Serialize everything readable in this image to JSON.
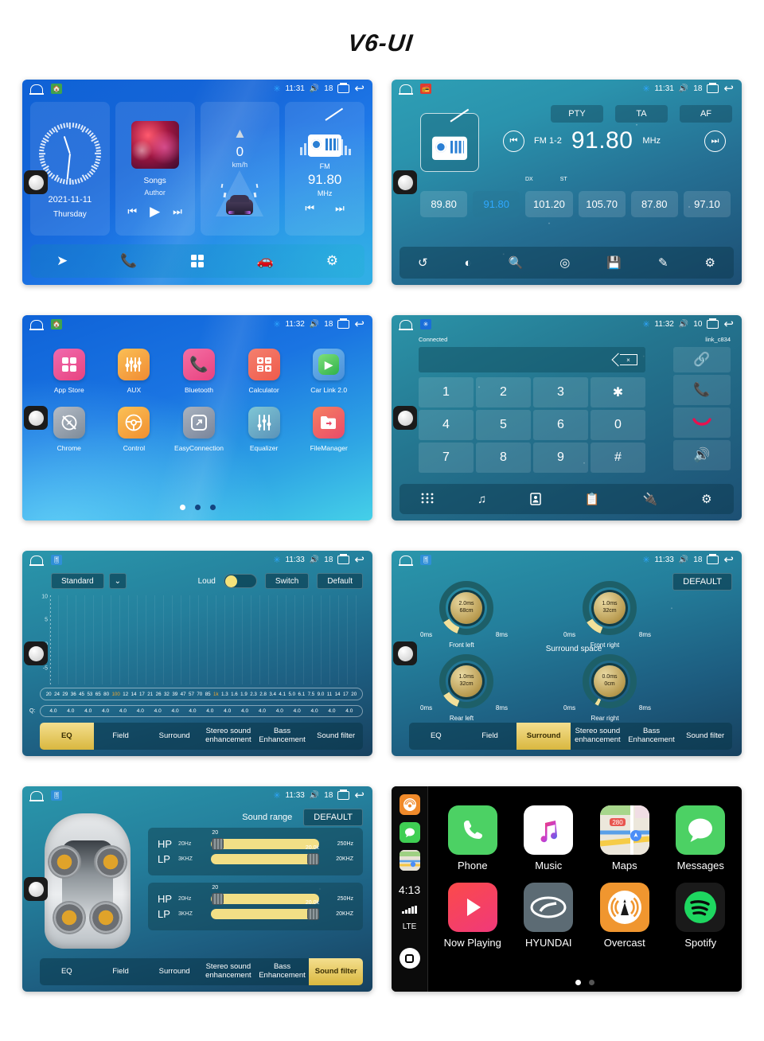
{
  "title": "V6-UI",
  "statusbar_common": {
    "bt_icon": "bluetooth-icon",
    "recents_icon": "recents-icon",
    "back_icon": "back-icon"
  },
  "screens": {
    "home": {
      "name": "home-screen",
      "status": {
        "time": "11:31",
        "volume": "18"
      },
      "clock_card": {
        "date": "2021-11-11",
        "day": "Thursday"
      },
      "music_card": {
        "title": "Songs",
        "author": "Author",
        "prev": "⏮",
        "play": "▶",
        "next": "⏭"
      },
      "drive_card": {
        "speed": "0",
        "unit": "km/h"
      },
      "radio_card": {
        "band": "FM",
        "freq": "91.80",
        "unit": "MHz",
        "prev": "⏮",
        "next": "⏭"
      },
      "dock": [
        "navigation-icon",
        "phone-icon",
        "apps-icon",
        "carplay-icon",
        "settings-icon"
      ]
    },
    "radio": {
      "name": "radio-screen",
      "status": {
        "time": "11:31",
        "volume": "18"
      },
      "rds": [
        "PTY",
        "TA",
        "AF"
      ],
      "band": "FM 1-2",
      "freq": "91.80",
      "unit": "MHz",
      "dx": "DX",
      "st": "ST",
      "presets": [
        "89.80",
        "91.80",
        "101.20",
        "105.70",
        "87.80",
        "97.10"
      ],
      "active_preset_index": 1,
      "toolbar": [
        "loop-icon",
        "contrast-icon",
        "search-icon",
        "scan-icon",
        "save-icon",
        "edit-icon",
        "settings-icon"
      ]
    },
    "apps": {
      "name": "apps-screen",
      "status": {
        "time": "11:32",
        "volume": "18"
      },
      "items": [
        {
          "label": "App Store",
          "icon": "grid-icon",
          "color": "#f0509a"
        },
        {
          "label": "AUX",
          "icon": "sliders-icon",
          "color": "#f5a23a"
        },
        {
          "label": "Bluetooth",
          "icon": "phone-icon",
          "color": "#f04f8e"
        },
        {
          "label": "Calculator",
          "icon": "calculator-icon",
          "color": "#f2644f"
        },
        {
          "label": "Car Link 2.0",
          "icon": "play-circle-icon",
          "color": "#4f9ee8"
        },
        {
          "label": "Chrome",
          "icon": "compass-off-icon",
          "color": "#9aa3ad"
        },
        {
          "label": "Control",
          "icon": "steering-wheel-icon",
          "color": "#f5a13a"
        },
        {
          "label": "EasyConnection",
          "icon": "screen-mirror-icon",
          "color": "#8d97a3"
        },
        {
          "label": "Equalizer",
          "icon": "faders-icon",
          "color": "#59b6c9"
        },
        {
          "label": "FileManager",
          "icon": "folder-icon",
          "color": "#f0564f"
        }
      ],
      "page_dots": 3,
      "active_dot": 0
    },
    "dialer": {
      "name": "dialer-screen",
      "status": {
        "time": "11:32",
        "volume": "10"
      },
      "connected_label": "Connected",
      "device_name": "link_c834",
      "input_value": "",
      "backspace_icon": "backspace-icon",
      "keys": [
        "1",
        "2",
        "3",
        "✱",
        "4",
        "5",
        "6",
        "0",
        "7",
        "8",
        "9",
        "#"
      ],
      "side": [
        "link-icon",
        "call-icon",
        "hangup-icon",
        "speaker-icon"
      ],
      "toolbar": [
        "keypad-icon",
        "music-icon",
        "contacts-icon",
        "call-log-icon",
        "bluetooth-connect-icon",
        "settings-icon"
      ]
    },
    "eq": {
      "name": "equalizer-screen",
      "status": {
        "time": "11:33",
        "volume": "18"
      },
      "preset_name": "Standard",
      "loud_label": "Loud",
      "loud_on": true,
      "switch_label": "Switch",
      "default_label": "Default",
      "y_ticks": [
        "10",
        "5",
        "0",
        "-5"
      ],
      "freq_labels": [
        "20",
        "24",
        "29",
        "36",
        "45",
        "53",
        "65",
        "80",
        "100",
        "12",
        "14",
        "17",
        "21",
        "26",
        "32",
        "39",
        "47",
        "57",
        "70",
        "85",
        "1k",
        "1.3",
        "1.6",
        "1.9",
        "2.3",
        "2.8",
        "3.4",
        "4.1",
        "5.0",
        "6.1",
        "7.5",
        "9.0",
        "11",
        "14",
        "17",
        "20"
      ],
      "freq_highlight": [
        "100",
        "1k"
      ],
      "q_label": "Q:",
      "q_values": [
        "4.0",
        "4.0",
        "4.0",
        "4.0",
        "4.0",
        "4.0",
        "4.0",
        "4.0",
        "4.0",
        "4.0",
        "4.0",
        "4.0",
        "4.0",
        "4.0",
        "4.0",
        "4.0",
        "4.0",
        "4.0"
      ],
      "tabs": [
        "EQ",
        "Field",
        "Surround",
        "Stereo sound enhancement",
        "Bass Enhancement",
        "Sound filter"
      ],
      "active_tab": "EQ"
    },
    "surround": {
      "name": "surround-screen",
      "status": {
        "time": "11:33",
        "volume": "18"
      },
      "default_label": "DEFAULT",
      "center_label": "Surround space",
      "knobs": [
        {
          "label": "Front left",
          "delay": "2.0ms",
          "distance": "68cm",
          "min": "0ms",
          "max": "8ms"
        },
        {
          "label": "Front right",
          "delay": "1.0ms",
          "distance": "32cm",
          "min": "0ms",
          "max": "8ms"
        },
        {
          "label": "Rear left",
          "delay": "1.0ms",
          "distance": "32cm",
          "min": "0ms",
          "max": "8ms"
        },
        {
          "label": "Rear right",
          "delay": "0.0ms",
          "distance": "0cm",
          "min": "0ms",
          "max": "8ms"
        }
      ],
      "tabs": [
        "EQ",
        "Field",
        "Surround",
        "Stereo sound enhancement",
        "Bass Enhancement",
        "Sound filter"
      ],
      "active_tab": "Surround"
    },
    "filter": {
      "name": "sound-filter-screen",
      "status": {
        "time": "11:33",
        "volume": "18"
      },
      "heading": "Sound range",
      "default_label": "DEFAULT",
      "groups": [
        {
          "rows": [
            {
              "tag": "HP",
              "lo": "20Hz",
              "hi": "250Hz",
              "value": "20",
              "pos": 3
            },
            {
              "tag": "LP",
              "lo": "3KHZ",
              "hi": "20KHZ",
              "value": "20.0k",
              "pos": 95
            }
          ]
        },
        {
          "rows": [
            {
              "tag": "HP",
              "lo": "20Hz",
              "hi": "250Hz",
              "value": "20",
              "pos": 3
            },
            {
              "tag": "LP",
              "lo": "3KHZ",
              "hi": "20KHZ",
              "value": "20.0k",
              "pos": 95
            }
          ]
        }
      ],
      "tabs": [
        "EQ",
        "Field",
        "Surround",
        "Stereo sound enhancement",
        "Bass Enhancement",
        "Sound filter"
      ],
      "active_tab": "Sound filter"
    },
    "carplay": {
      "name": "carplay-screen",
      "clock": "4:13",
      "network": "LTE",
      "sidebar": [
        "overcast-icon",
        "messages-icon",
        "maps-icon"
      ],
      "apps": [
        {
          "label": "Phone",
          "icon": "phone-icon"
        },
        {
          "label": "Music",
          "icon": "music-icon"
        },
        {
          "label": "Maps",
          "icon": "maps-icon"
        },
        {
          "label": "Messages",
          "icon": "messages-icon"
        },
        {
          "label": "Now Playing",
          "icon": "now-playing-icon"
        },
        {
          "label": "HYUNDAI",
          "icon": "hyundai-icon"
        },
        {
          "label": "Overcast",
          "icon": "overcast-icon"
        },
        {
          "label": "Spotify",
          "icon": "spotify-icon"
        }
      ],
      "page_dots": 2,
      "active_dot": 0
    }
  }
}
